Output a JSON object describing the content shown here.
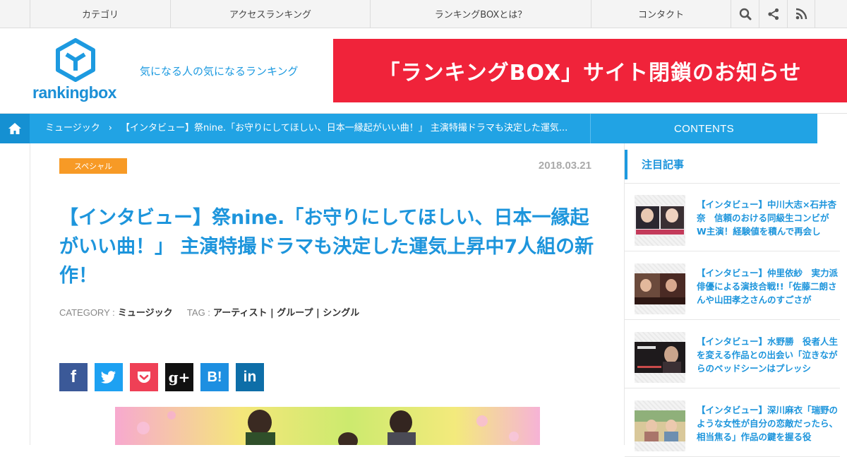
{
  "topnav": {
    "items": [
      "カテゴリ",
      "アクセスランキング",
      "ランキングBOXとは？",
      "コンタクト"
    ],
    "icons": [
      "search-icon",
      "share-icon",
      "rss-icon"
    ]
  },
  "header": {
    "logo_text": "rankingbox",
    "tagline": "気になる人の気になるランキング",
    "banner": "「ランキングBOX」サイト閉鎖のお知らせ"
  },
  "breadcrumb": {
    "category": "ミュージック",
    "separator": "›",
    "current": "【インタビュー】祭nine.「お守りにしてほしい、日本一縁起がいい曲！」 主演特撮ドラマも決定した運気...",
    "contents_label": "CONTENTS"
  },
  "article": {
    "category_badge": "スペシャル",
    "date": "2018.03.21",
    "title": "【インタビュー】祭nine.「お守りにしてほしい、日本一縁起がいい曲！」 主演特撮ドラマも決定した運気上昇中7人組の新作！",
    "category_label": "CATEGORY :",
    "category_value": "ミュージック",
    "tag_label": "TAG :",
    "tags": "アーティスト | グループ | シングル"
  },
  "share": {
    "buttons": [
      {
        "name": "facebook",
        "glyph": "f",
        "color": "#3b5998"
      },
      {
        "name": "twitter",
        "glyph": "",
        "color": "#1da1f2"
      },
      {
        "name": "pocket",
        "glyph": "",
        "color": "#ef4056"
      },
      {
        "name": "google-plus",
        "glyph": "g+",
        "color": "#111111"
      },
      {
        "name": "hatena",
        "glyph": "B!",
        "color": "#1d8fe1"
      },
      {
        "name": "linkedin",
        "glyph": "in",
        "color": "#0e6ea8"
      }
    ]
  },
  "sidebar": {
    "heading": "注目記事",
    "items": [
      {
        "title": "【インタビュー】中川大志×石井杏奈　信頼のおける同級生コンビがW主演！経験値を積んで再会し"
      },
      {
        "title": "【インタビュー】仲里依紗　実力派俳優による演技合戦!!「佐藤二朗さんや山田孝之さんのすごさが"
      },
      {
        "title": "【インタビュー】水野勝　役者人生を変える作品との出会い「泣きながらのベッドシーンはプレッシ"
      },
      {
        "title": "【インタビュー】深川麻衣「瑞野のような女性が自分の恋敵だったら、相当焦る」作品の鍵を握る役"
      }
    ]
  },
  "colors": {
    "accent_blue": "#21a3e4",
    "banner_red": "#f0233a",
    "badge_orange": "#f79a26"
  }
}
